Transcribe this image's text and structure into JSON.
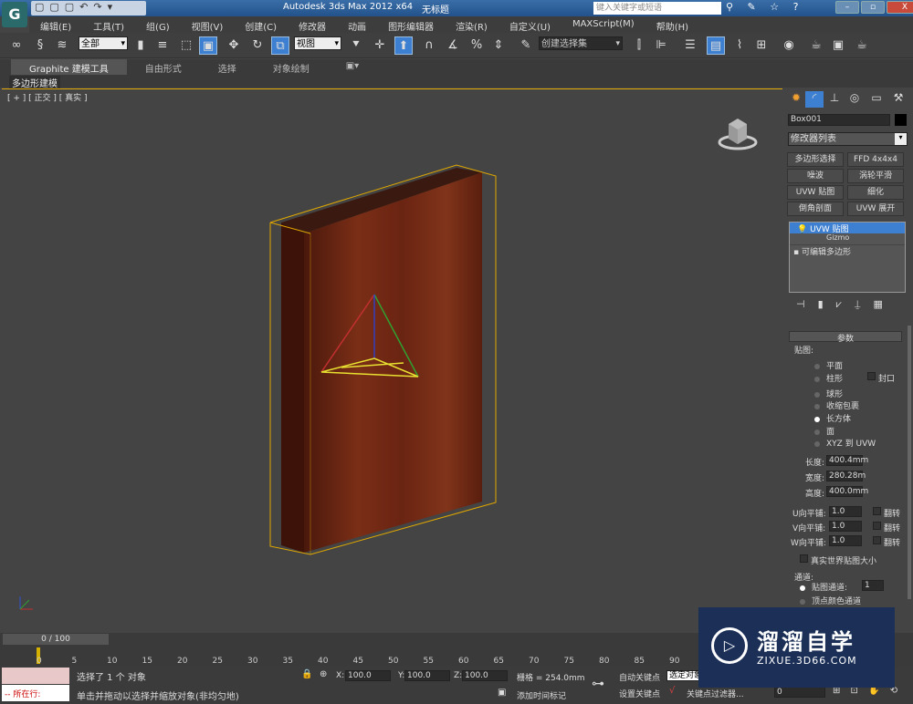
{
  "title": {
    "app": "Autodesk 3ds Max  2012 x64",
    "doc": "无标题",
    "search_placeholder": "键入关键字或短语"
  },
  "quick_access": "▢▢▢↶↷▾",
  "menu": [
    "编辑(E)",
    "工具(T)",
    "组(G)",
    "视图(V)",
    "创建(C)",
    "修改器",
    "动画",
    "图形编辑器",
    "渲染(R)",
    "自定义(U)",
    "MAXScript(M)",
    "帮助(H)"
  ],
  "toolbar": {
    "filter": "全部",
    "coord": "视图",
    "named_selection": "创建选择集"
  },
  "ribbon": {
    "tabs": [
      "Graphite 建模工具",
      "自由形式",
      "选择",
      "对象绘制"
    ],
    "sub": "多边形建模"
  },
  "viewport": {
    "label": "[ + ] [ 正交 ] [ 真实 ]",
    "accent": "#e0a800"
  },
  "panel": {
    "object_name": "Box001",
    "modifier_list": "修改器列表",
    "buttons": [
      "多边形选择",
      "FFD 4x4x4",
      "噪波",
      "涡轮平滑",
      "UVW 贴图",
      "细化",
      "倒角剖面",
      "UVW 展开"
    ],
    "stack": {
      "uvw": "UVW 贴图",
      "gizmo": "Gizmo",
      "editpoly": "可编辑多边形"
    },
    "rollout": "参数",
    "mapping_label": "贴图:",
    "mapping": [
      "平面",
      "柱形",
      "球形",
      "收缩包裹",
      "长方体",
      "面",
      "XYZ 到 UVW"
    ],
    "selected_mapping": "长方体",
    "cap": "封口",
    "length_label": "长度:",
    "length": "400.4mm",
    "width_label": "宽度:",
    "width": "280.28m",
    "height_label": "高度:",
    "height": "400.0mm",
    "u_label": "U向平铺:",
    "u": "1.0",
    "v_label": "V向平铺:",
    "v": "1.0",
    "w_label": "W向平铺:",
    "w": "1.0",
    "flip": "翻转",
    "realworld": "真实世界贴图大小",
    "channel_label": "通道:",
    "map_channel_label": "贴图通道:",
    "map_channel": "1",
    "vertex_color": "顶点颜色通道"
  },
  "timeline": {
    "frame": "0 / 100",
    "ticks": [
      "0",
      "5",
      "10",
      "15",
      "20",
      "25",
      "30",
      "35",
      "40",
      "45",
      "50",
      "55",
      "60",
      "65",
      "70",
      "75",
      "80",
      "85",
      "90"
    ]
  },
  "status": {
    "row_label": "所在行:",
    "selected": "选择了 1 个 对象",
    "prompt": "单击并拖动以选择并缩放对象(非均匀地)",
    "x": "100.0",
    "y": "100.0",
    "z": "100.0",
    "grid": "栅格 = 254.0mm",
    "add_time_tag": "添加时间标记",
    "auto_key": "自动关键点",
    "set_key": "设置关键点",
    "selected_obj": "选定对象",
    "key_filters": "关键点过滤器...",
    "frame": "0"
  },
  "watermark": {
    "name": "溜溜自学",
    "url": "ZIXUE.3D66.COM"
  }
}
